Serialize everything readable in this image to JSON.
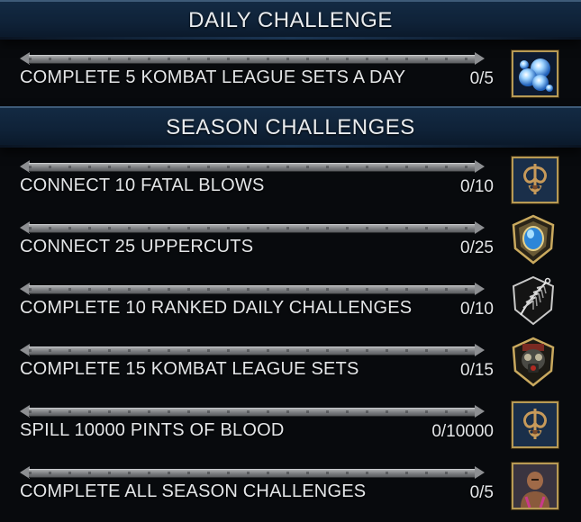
{
  "daily": {
    "header": "DAILY CHALLENGE",
    "items": [
      {
        "label": "COMPLETE 5 KOMBAT LEAGUE SETS A DAY",
        "progress": "0/5",
        "current": 0,
        "goal": 5,
        "reward_icon": "koin-orbs-icon"
      }
    ]
  },
  "season": {
    "header": "SEASON CHALLENGES",
    "items": [
      {
        "label": "CONNECT 10 FATAL BLOWS",
        "progress": "0/10",
        "current": 0,
        "goal": 10,
        "reward_icon": "emblem-icon"
      },
      {
        "label": "CONNECT 25 UPPERCUTS",
        "progress": "0/25",
        "current": 0,
        "goal": 25,
        "reward_icon": "blue-gem-shield-icon"
      },
      {
        "label": "COMPLETE 10 RANKED DAILY CHALLENGES",
        "progress": "0/10",
        "current": 0,
        "goal": 10,
        "reward_icon": "feather-charm-icon"
      },
      {
        "label": "COMPLETE 15 KOMBAT LEAGUE SETS",
        "progress": "0/15",
        "current": 0,
        "goal": 15,
        "reward_icon": "gas-mask-icon"
      },
      {
        "label": "SPILL 10000 PINTS OF BLOOD",
        "progress": "0/10000",
        "current": 0,
        "goal": 10000,
        "reward_icon": "emblem-icon"
      },
      {
        "label": "COMPLETE ALL SEASON CHALLENGES",
        "progress": "0/5",
        "current": 0,
        "goal": 5,
        "reward_icon": "fighter-portrait-icon"
      }
    ]
  },
  "colors": {
    "header_bg": "#0f2238",
    "frame_gold": "#b79a55",
    "bar_fill": "#d8b24a",
    "text": "#e4e6e8"
  }
}
